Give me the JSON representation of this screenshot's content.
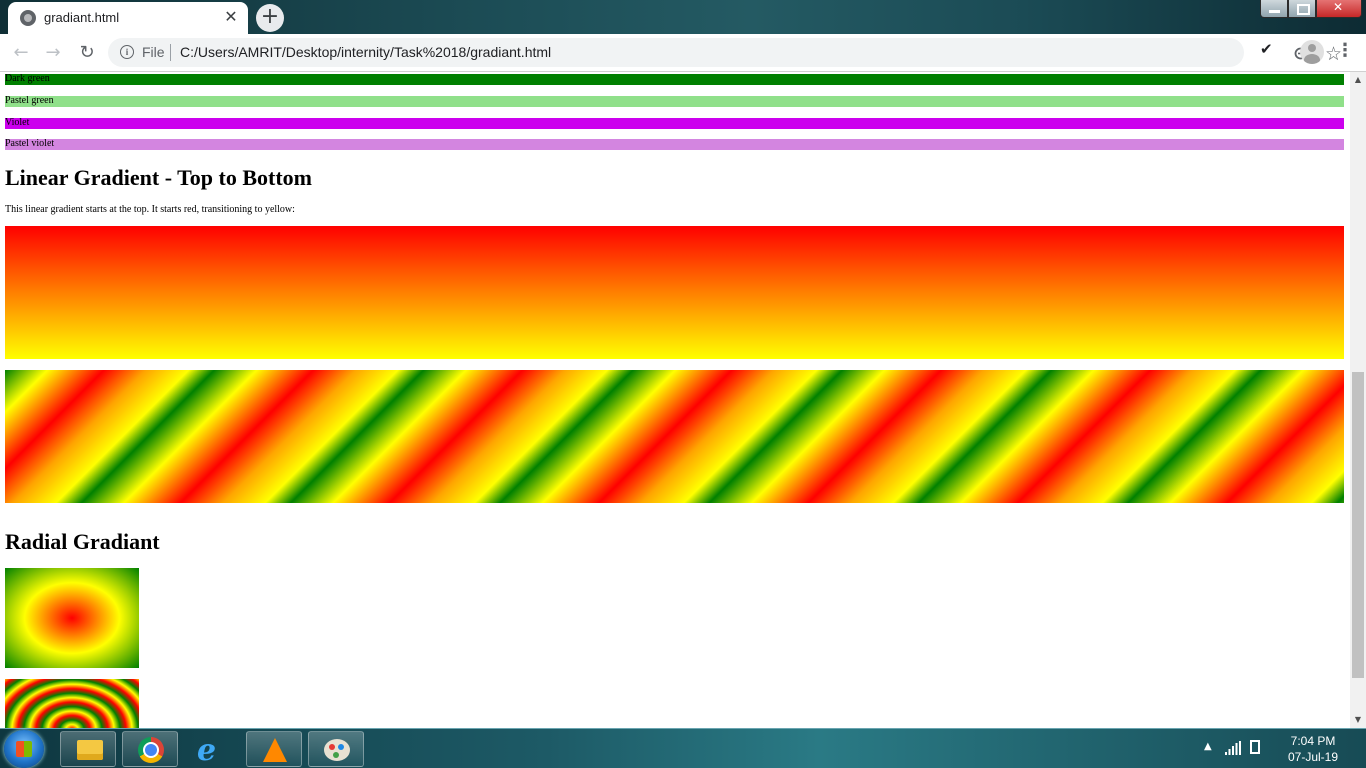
{
  "browser": {
    "tab_title": "gradiant.html",
    "new_tab_label": "+",
    "close_tab_label": "✕",
    "scheme_label": "File",
    "url": "C:/Users/AMRIT/Desktop/internity/Task%2018/gradiant.html"
  },
  "page": {
    "color_bars": [
      {
        "label": "Dark green",
        "color": "#008000"
      },
      {
        "label": "Pastel green",
        "color": "#90e08a"
      },
      {
        "label": "Violet",
        "color": "#cc00ee"
      },
      {
        "label": "Pastel violet",
        "color": "#d385e0"
      }
    ],
    "linear_heading": "Linear Gradient - Top to Bottom",
    "linear_text": "This linear gradient starts at the top. It starts red, transitioning to yellow:",
    "radial_heading": "Radial Gradiant"
  },
  "taskbar": {
    "time": "7:04 PM",
    "date": "07-Jul-19"
  }
}
